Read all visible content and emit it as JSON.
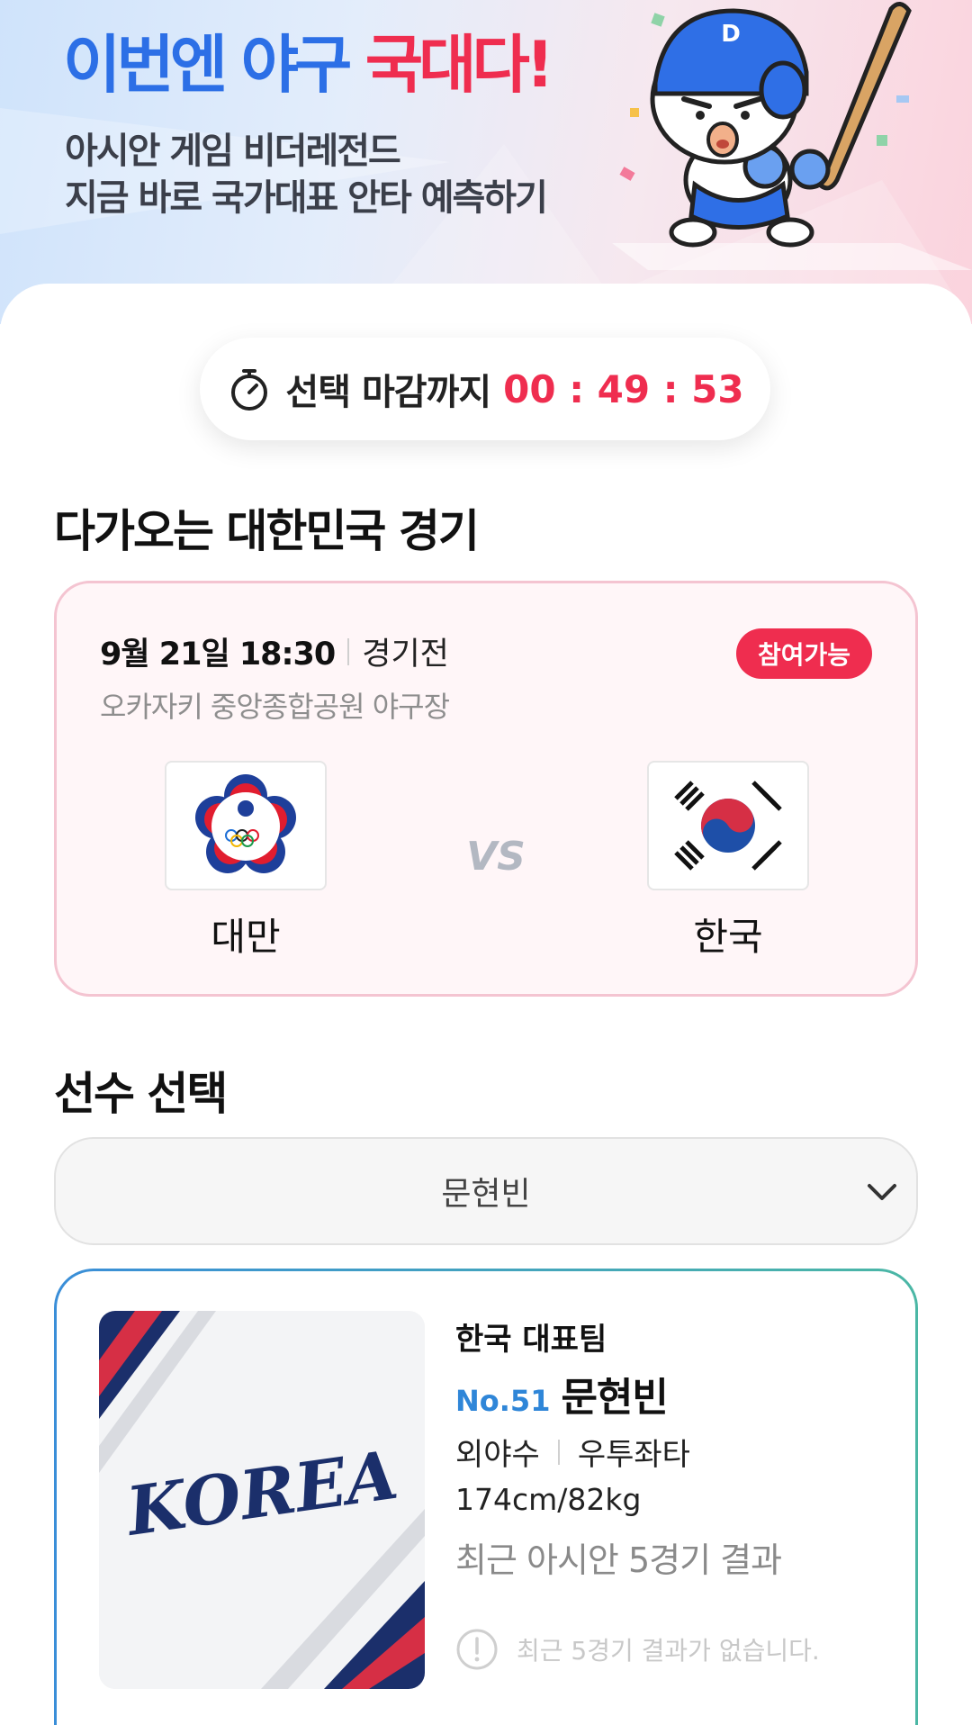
{
  "hero": {
    "title_blue": "이번엔 야구 ",
    "title_red": "국대다!",
    "subtitle_line1": "아시안 게임 비더레전드",
    "subtitle_line2": "지금 바로 국가대표 안타 예측하기",
    "mascot_icon": "baseball-mascot-icon",
    "helmet_letter": "D"
  },
  "timer": {
    "label": "선택 마감까지",
    "value": "00 : 49 : 53",
    "icon": "stopwatch-icon"
  },
  "upcoming": {
    "section_title": "다가오는 대한민국 경기",
    "date": "9월 21일 18:30",
    "status": "경기전",
    "venue": "오카자키 중앙종합공원 야구장",
    "badge": "참여가능",
    "team_a": {
      "name": "대만",
      "flag_icon": "chinese-taipei-flag-icon"
    },
    "vs": "VS",
    "team_b": {
      "name": "한국",
      "flag_icon": "korea-flag-icon"
    }
  },
  "player_section": {
    "title": "선수 선택",
    "selected": "문현빈",
    "chevron_icon": "chevron-down-icon"
  },
  "player": {
    "team": "한국 대표팀",
    "number": "No.51",
    "name": "문현빈",
    "position": "외야수",
    "bats_throws": "우투좌타",
    "body": "174cm/82kg",
    "recent_title": "최근 아시안 5경기 결과",
    "empty_message": "최근 5경기 결과가 없습니다.",
    "photo_text": "KOREA"
  },
  "colors": {
    "accent_red": "#ef2d4f",
    "accent_blue": "#2c6fe6",
    "number_blue": "#2f86d8"
  }
}
